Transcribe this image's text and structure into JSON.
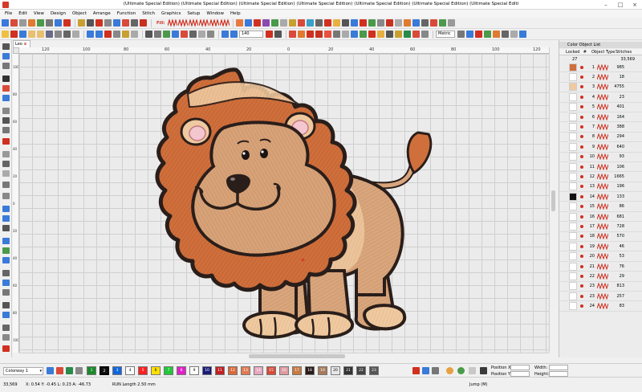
{
  "window": {
    "title": "(Ultimate Special Edition) (Ultimate Special Edition) (Ultimate Special Edition) (Ultimate Special Edition) (Ultimate Special Edition) (Ultimate Special Edition) (Ultimate Special Editi",
    "minimize": "–",
    "maximize": "□",
    "close": "×"
  },
  "menu": [
    "File",
    "Edit",
    "View",
    "Design",
    "Object",
    "Arrange",
    "Function",
    "Stitch",
    "Graphics",
    "Setup",
    "Window",
    "Help"
  ],
  "toolbar": {
    "fill_label": "Fill:",
    "zoom_value": "140",
    "units_value": "Metric",
    "view_3d": "3D"
  },
  "document_tab": {
    "label": "Leo",
    "close": "x"
  },
  "ruler": {
    "top_labels": [
      "120",
      "100",
      "80",
      "60",
      "40",
      "20",
      "0",
      "20",
      "40",
      "60",
      "80",
      "100",
      "120"
    ],
    "left_labels": [
      "100",
      "80",
      "60",
      "40",
      "20",
      "0",
      "20",
      "40",
      "60",
      "80",
      "100"
    ]
  },
  "objects_panel": {
    "title": "Color Object List",
    "columns": {
      "group": "Locked",
      "number": "#",
      "type": "Object Type",
      "stitches": "Stitches"
    },
    "summary": {
      "count": "27",
      "stitches": "33,569"
    },
    "rows": [
      {
        "num": "1",
        "stitches": "985"
      },
      {
        "num": "2",
        "stitches": "18"
      },
      {
        "num": "3",
        "stitches": "4755"
      },
      {
        "num": "4",
        "stitches": "23"
      },
      {
        "num": "5",
        "stitches": "401"
      },
      {
        "num": "6",
        "stitches": "164"
      },
      {
        "num": "7",
        "stitches": "388"
      },
      {
        "num": "8",
        "stitches": "294"
      },
      {
        "num": "9",
        "stitches": "640"
      },
      {
        "num": "10",
        "stitches": "93"
      },
      {
        "num": "11",
        "stitches": "106"
      },
      {
        "num": "12",
        "stitches": "1665"
      },
      {
        "num": "13",
        "stitches": "196"
      },
      {
        "num": "14",
        "stitches": "133"
      },
      {
        "num": "15",
        "stitches": "86"
      },
      {
        "num": "16",
        "stitches": "681"
      },
      {
        "num": "17",
        "stitches": "728"
      },
      {
        "num": "18",
        "stitches": "570"
      },
      {
        "num": "19",
        "stitches": "46"
      },
      {
        "num": "20",
        "stitches": "53"
      },
      {
        "num": "21",
        "stitches": "76"
      },
      {
        "num": "22",
        "stitches": "29"
      },
      {
        "num": "23",
        "stitches": "813"
      },
      {
        "num": "23",
        "stitches": "257"
      },
      {
        "num": "24",
        "stitches": "83"
      }
    ]
  },
  "colorbar": {
    "colorway": "Colorway 1",
    "swatches": [
      {
        "num": "1",
        "color": "#1a8a2a"
      },
      {
        "num": "2",
        "color": "#111111"
      },
      {
        "num": "3",
        "color": "#1166dd"
      },
      {
        "num": "4",
        "color": "#ffffff"
      },
      {
        "num": "5",
        "color": "#ff2020"
      },
      {
        "num": "6",
        "color": "#ffe000"
      },
      {
        "num": "7",
        "color": "#22c83a"
      },
      {
        "num": "8",
        "color": "#e020c8"
      },
      {
        "num": "9",
        "color": "#ffffff"
      },
      {
        "num": "10",
        "color": "#1a1a7a"
      },
      {
        "num": "11",
        "color": "#c02020"
      },
      {
        "num": "12",
        "color": "#d86a3a"
      },
      {
        "num": "13",
        "color": "#e07a50"
      },
      {
        "num": "14",
        "color": "#e8a8c0"
      },
      {
        "num": "15",
        "color": "#d84a3a"
      },
      {
        "num": "16",
        "color": "#e09aa0"
      },
      {
        "num": "17",
        "color": "#c87a40"
      },
      {
        "num": "18",
        "color": "#2a1a1a"
      },
      {
        "num": "19",
        "color": "#a87a5a"
      },
      {
        "num": "20",
        "color": "#e8e8e8"
      },
      {
        "num": "21",
        "color": "#333333"
      },
      {
        "num": "22",
        "color": "#444444"
      },
      {
        "num": "23",
        "color": "#555555"
      }
    ],
    "position_x_label": "Position X:",
    "position_y_label": "Position Y:",
    "width_label": "Width:",
    "height_label": "Height:"
  },
  "statusbar": {
    "stitch_count": "33,569",
    "coords": "X: 0.54 Y: -0.45 L: 0.23 A: -46.73",
    "run_length": "RUN Length 2.50 mm",
    "jump": "Jump (M)"
  }
}
